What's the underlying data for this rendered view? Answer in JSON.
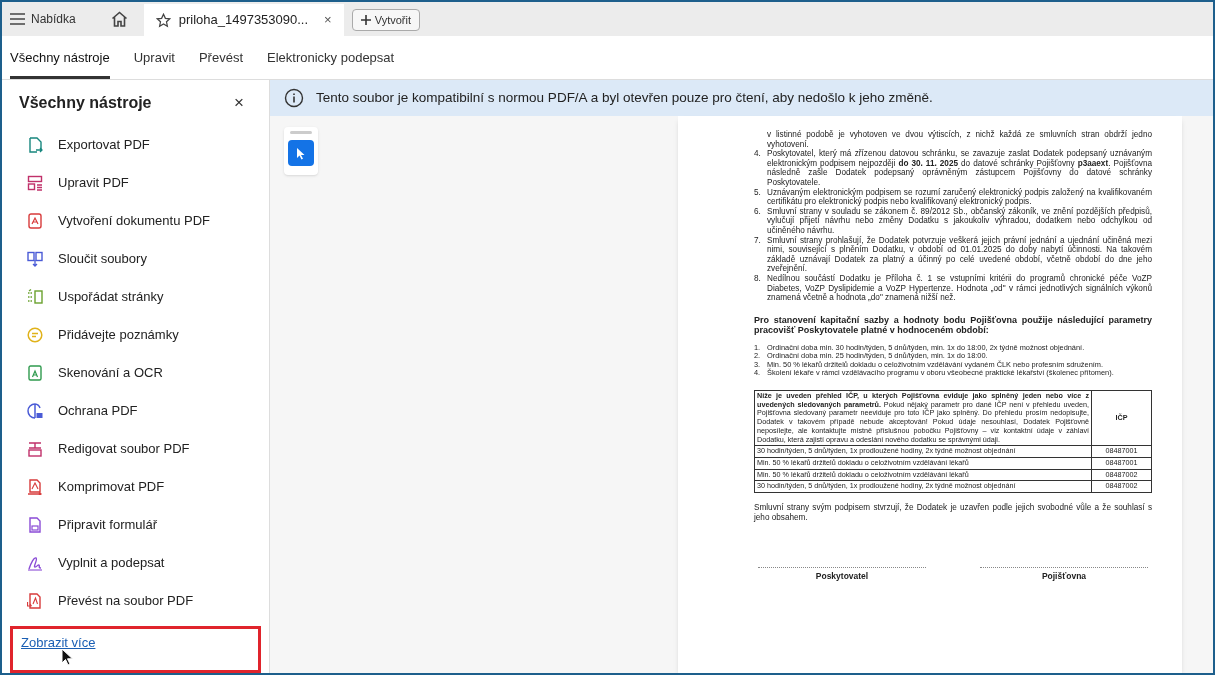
{
  "top_bar": {
    "menu_label": "Nabídka",
    "tab": {
      "title": "priloha_1497353090...",
      "close": "×"
    },
    "new_button": "Vytvořit"
  },
  "toolbar_tabs": [
    {
      "label": "Všechny nástroje",
      "selected": true
    },
    {
      "label": "Upravit",
      "selected": false
    },
    {
      "label": "Převést",
      "selected": false
    },
    {
      "label": "Elektronicky podepsat",
      "selected": false
    }
  ],
  "sidebar": {
    "title": "Všechny nástroje",
    "close": "×",
    "items": [
      {
        "label": "Exportovat PDF"
      },
      {
        "label": "Upravit PDF"
      },
      {
        "label": "Vytvoření dokumentu PDF"
      },
      {
        "label": "Sloučit soubory"
      },
      {
        "label": "Uspořádat stránky"
      },
      {
        "label": "Přidávejte poznámky"
      },
      {
        "label": "Skenování a OCR"
      },
      {
        "label": "Ochrana PDF"
      },
      {
        "label": "Redigovat soubor PDF"
      },
      {
        "label": "Komprimovat PDF"
      },
      {
        "label": "Připravit formulář"
      },
      {
        "label": "Vyplnit a podepsat"
      },
      {
        "label": "Převést na soubor PDF"
      }
    ],
    "more_link": "Zobrazit více"
  },
  "banner": {
    "text": "Tento soubor je kompatibilní s normou PDF/A a byl otevřen pouze pro čtení, aby nedošlo k jeho změně."
  },
  "document": {
    "clauses": [
      {
        "text": "v listinné podobě je vyhotoven ve dvou výtiscích, z nichž každá ze smluvních stran obdrží jedno vyhotovení."
      },
      {
        "number": "4.",
        "text": "Poskytovatel, který má zřízenou datovou schránku, se zavazuje zaslat Dodatek podepsaný uznávaným elektronickým podpisem nejpozději **do 30. 11. 2025** do datové schránky Pojišťovny **p3aaext**. Pojišťovna následně zašle Dodatek podepsaný oprávněným zástupcem Pojišťovny do datové schránky Poskytovatele."
      },
      {
        "number": "5.",
        "text": "Uznávaným elektronickým podpisem se rozumí zaručený elektronický podpis založený na kvalifikovaném certifikátu pro elektronický podpis nebo kvalifikovaný elektronický podpis."
      },
      {
        "number": "6.",
        "text": "Smluvní strany v souladu se zákonem č. 89/2012 Sb., občanský zákoník, ve znění pozdějších předpisů, vylučují přijetí návrhu nebo změny Dodatku s jakoukoliv výhradou, dodatkem nebo odchylkou od učiněného návrhu."
      },
      {
        "number": "7.",
        "text": "Smluvní strany prohlašují, že Dodatek potvrzuje veškerá jejich právní jednání a ujednání učiněná mezi nimi, související s plněním Dodatku, v období od 01.01.2025 do doby nabytí účinnosti. Na takovém základě uznávají Dodatek za platný a účinný po celé uvedené období, včetně období do dne jeho zveřejnění."
      },
      {
        "number": "8.",
        "text": "Nedílnou součástí Dodatku je Příloha č. 1 se vstupními kritérii do programů chronické péče VoZP Diabetes, VoZP Dyslipidemie a VoZP Hypertenze. Hodnota „od\" v rámci jednotlivých signálních výkonů znamená včetně a hodnota „do\" znamená nižší než."
      }
    ],
    "heading": "Pro stanovení kapitační sazby a hodnoty bodu Pojišťovna použije následující parametry pracovišť Poskytovatele platné v hodnoceném období:",
    "parameters": [
      {
        "number": "1.",
        "text": "Ordinační doba min. 30 hodin/týden, 5 dnů/týden, min. 1x do 18:00, 2x týdně možnost objednání."
      },
      {
        "number": "2.",
        "text": "Ordinační doba min. 25 hodin/týden, 5 dnů/týden, min. 1x do 18:00."
      },
      {
        "number": "3.",
        "text": "Min. 50 % lékařů držitelů dokladu o celoživotním vzdělávání vydaném ČLK nebo profesním sdružením."
      },
      {
        "number": "4.",
        "text": "Školení lékaře v rámci vzdělávacího programu v oboru všeobecné praktické lékařství (školenec přítomen)."
      }
    ],
    "table": {
      "columns": [
        "**Níže je uveden přehled IČP, u kterých Pojišťovna eviduje jako splněný jeden nebo více z uvedených sledovaných parametrů.** Pokud nějaký parametr pro dané IČP není v přehledu uveden, Pojišťovna sledovaný parametr neeviduje pro toto IČP jako splněný. Do přehledu prosím nedopisujte, Dodatek v takovém případě nebude akceptován! Pokud údaje nesouhlasí, Dodatek Pojišťovně neposílejte, ale kontaktujte místně příslušnou pobočku Pojišťovny – viz kontaktní údaje v záhlaví Dodatku, která zajistí opravu a odeslání nového dodatku se správnými údaji.",
        "IČP"
      ],
      "rows": [
        [
          "30 hodin/týden, 5 dnů/týden, 1x prodloužené hodiny, 2x týdně možnost objednání",
          "08487001"
        ],
        [
          "Min. 50 % lékařů držitelů dokladu o celoživotním vzdělávání lékařů",
          "08487001"
        ],
        [
          "Min. 50 % lékařů držitelů dokladu o celoživotním vzdělávání lékařů",
          "08487002"
        ],
        [
          "30 hodin/týden, 5 dnů/týden, 1x prodloužené hodiny, 2x týdně možnost objednání",
          "08487002"
        ]
      ]
    },
    "closing": "Smluvní strany svým podpisem stvrzují, že Dodatek je uzavřen podle jejich svobodné vůle a že souhlasí s jeho obsahem.",
    "signatures": [
      "Poskytovatel",
      "Pojišťovna"
    ]
  }
}
